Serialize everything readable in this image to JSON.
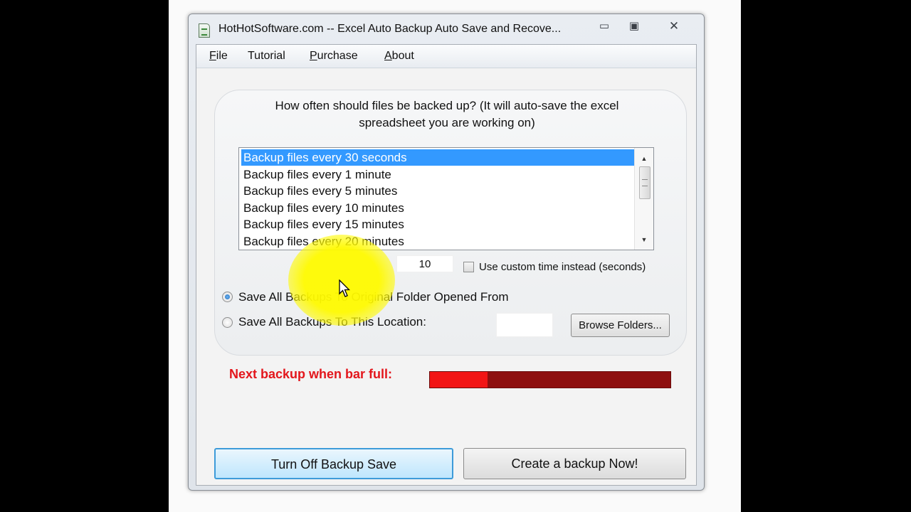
{
  "window": {
    "title": "HotHotSoftware.com -- Excel Auto Backup Auto Save and Recove...",
    "controls": {
      "minimize": "▭",
      "maximize": "▣",
      "close": "✕"
    }
  },
  "menu": [
    {
      "underline": "F",
      "rest": "ile"
    },
    {
      "underline": "",
      "rest": "Tutorial"
    },
    {
      "underline": "P",
      "rest": "urchase"
    },
    {
      "underline": "A",
      "rest": "bout"
    }
  ],
  "backup": {
    "question_line1": "How often should files be backed up? (It will auto-save the excel",
    "question_line2": "spreadsheet you are working on)",
    "intervals": [
      "Backup files every 30 seconds",
      "Backup files every 1 minute",
      "Backup files every 5 minutes",
      "Backup files every 10 minutes",
      "Backup files every 15 minutes",
      "Backup files every 20 minutes"
    ],
    "selected_index": 0,
    "custom_seconds": "10",
    "custom_checkbox_label": "Use custom time instead (seconds)",
    "custom_checked": false
  },
  "location": {
    "option_original": "Save All Backups To Original Folder Opened From",
    "option_custom": "Save All Backups To This Location:",
    "selected": "original",
    "path_value": "",
    "browse_label": "Browse Folders..."
  },
  "progress": {
    "label": "Next backup when bar full:",
    "fraction": 0.24
  },
  "actions": {
    "turn_off": "Turn Off Backup Save",
    "backup_now": "Create a backup Now!"
  },
  "colors": {
    "selection": "#3399ff",
    "progress_track": "#8e0f0f",
    "progress_fill": "#f21515",
    "alert_text": "#e3161c"
  }
}
